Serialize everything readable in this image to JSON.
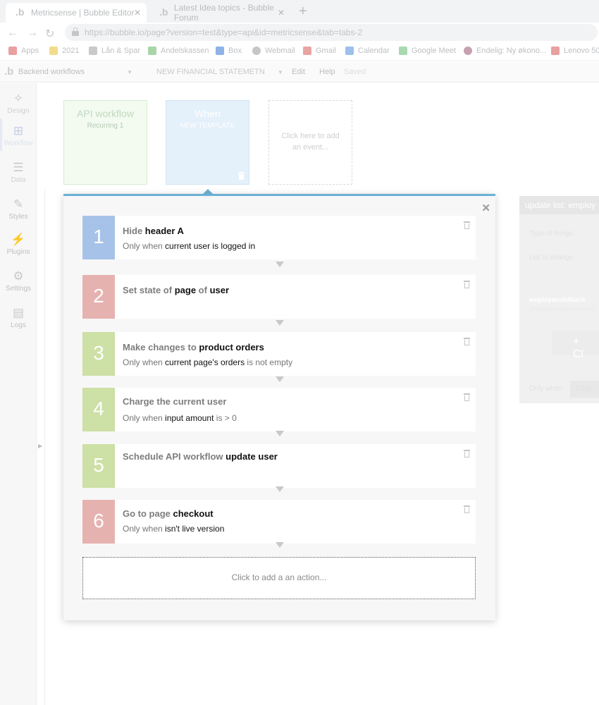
{
  "browser": {
    "tabs": [
      {
        "title": "Metricsense | Bubble Editor",
        "active": true
      },
      {
        "title": "Latest Idea topics - Bubble Forum",
        "active": false
      }
    ],
    "url": "https://bubble.io/page?version=test&type=api&id=metricsense&tab=tabs-2",
    "bookmarks": [
      {
        "label": "Apps",
        "icon": "apps-grid-icon",
        "color": "#e8a0a0"
      },
      {
        "label": "2021",
        "icon": "folder-icon",
        "color": "#f2dc8c"
      },
      {
        "label": "Lån & Spar",
        "icon": "lan-spar-icon",
        "color": "#c9c9c9"
      },
      {
        "label": "Andelskassen",
        "icon": "andelskassen-icon",
        "color": "#a8d6a8"
      },
      {
        "label": "Box",
        "icon": "box-icon",
        "color": "#8fb3e8"
      },
      {
        "label": "Webmail",
        "icon": "globe-icon",
        "color": "#c6c6c6"
      },
      {
        "label": "Gmail",
        "icon": "gmail-icon",
        "color": "#e8a3a3"
      },
      {
        "label": "Calendar",
        "icon": "calendar-icon",
        "color": "#9dc0ec"
      },
      {
        "label": "Google Meet",
        "icon": "meet-icon",
        "color": "#a8d9b0"
      },
      {
        "label": "Endelig: Ny økono...",
        "icon": "site-icon",
        "color": "#c8a0b0"
      },
      {
        "label": "Lenovo 50",
        "icon": "lenovo-icon",
        "color": "#e8a0a0"
      }
    ]
  },
  "editor": {
    "page_select": "Backend workflows",
    "workflow_select": "NEW FINANCIAL STATEMETN",
    "menu_edit": "Edit",
    "menu_help": "Help",
    "status": "Saved"
  },
  "sidebar": {
    "items": [
      {
        "label": "Design",
        "icon": "design-icon"
      },
      {
        "label": "Workflow",
        "icon": "workflow-icon"
      },
      {
        "label": "Data",
        "icon": "data-icon"
      },
      {
        "label": "Styles",
        "icon": "brush-icon"
      },
      {
        "label": "Plugins",
        "icon": "plugin-icon"
      },
      {
        "label": "Settings",
        "icon": "gear-icon"
      },
      {
        "label": "Logs",
        "icon": "document-icon"
      }
    ]
  },
  "events": {
    "api": {
      "title": "API workflow",
      "subtitle": "Recurring 1"
    },
    "when": {
      "title": "When",
      "subtitle": "NEW TEMPLATE"
    },
    "add": {
      "label": "Click here to add an event..."
    }
  },
  "right_panel": {
    "title": "update list: employ",
    "type_label": "Type of things",
    "list_label": "List to change",
    "chip": "employeesfallback",
    "chip_sub": "(worthereallyemployee)",
    "button": "+ Cl",
    "only_when": "Only when",
    "only_when_value": "Click"
  },
  "actions": {
    "steps": [
      {
        "num": "1",
        "color": "#a6c2e8",
        "verb": "Hide",
        "target": "header A",
        "cond_pre": "Only when",
        "cond_expr": "current user is logged in",
        "cond_post": ""
      },
      {
        "num": "2",
        "color": "#e6b2b0",
        "verb": "Set state of",
        "target": "page",
        "mid": "of",
        "target2": "user",
        "cond_pre": "",
        "cond_expr": "",
        "cond_post": ""
      },
      {
        "num": "3",
        "color": "#cde0a5",
        "verb": "Make changes to",
        "target": "product orders",
        "cond_pre": "Only when",
        "cond_expr": "current page's orders",
        "cond_post": "is not empty"
      },
      {
        "num": "4",
        "color": "#cde0a5",
        "verb": "Charge the current user",
        "target": "",
        "cond_pre": "Only when",
        "cond_expr": "input amount",
        "cond_post": "is > 0"
      },
      {
        "num": "5",
        "color": "#cde0a5",
        "verb": "Schedule API workflow",
        "target": "update user",
        "cond_pre": "",
        "cond_expr": "",
        "cond_post": ""
      },
      {
        "num": "6",
        "color": "#e6b2b0",
        "verb": "Go to page",
        "target": "checkout",
        "cond_pre": "Only when",
        "cond_expr": "isn't live version",
        "cond_post": ""
      }
    ],
    "add_label": "Click to add a an action..."
  }
}
